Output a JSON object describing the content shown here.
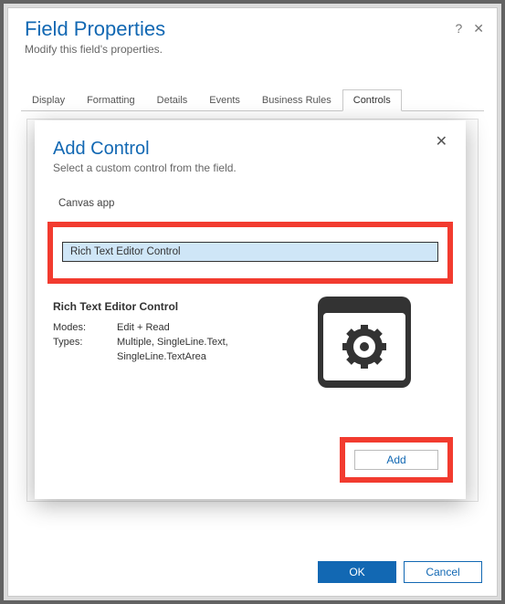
{
  "properties": {
    "title": "Field Properties",
    "subtitle": "Modify this field's properties.",
    "tabs": [
      "Display",
      "Formatting",
      "Details",
      "Events",
      "Business Rules",
      "Controls"
    ],
    "active_tab": "Controls",
    "buttons": {
      "ok": "OK",
      "cancel": "Cancel"
    }
  },
  "modal": {
    "title": "Add Control",
    "subtitle": "Select a custom control from the field.",
    "list": {
      "item0": "Canvas app",
      "selected": "Rich Text Editor Control"
    },
    "detail": {
      "title": "Rich Text Editor Control",
      "labels": {
        "modes": "Modes:",
        "types": "Types:"
      },
      "values": {
        "modes": "Edit + Read",
        "types_line1": "Multiple, SingleLine.Text,",
        "types_line2": "SingleLine.TextArea"
      }
    },
    "add_label": "Add"
  }
}
